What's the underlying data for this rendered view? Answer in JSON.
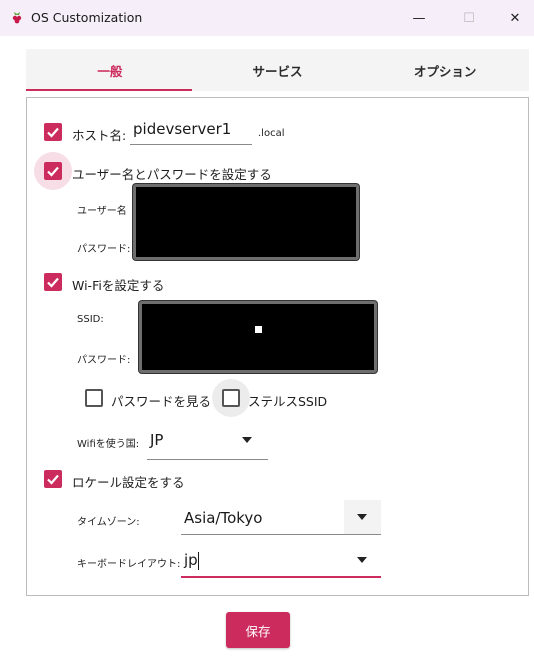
{
  "window": {
    "title": "OS Customization",
    "minimize_glyph": "—",
    "maximize_glyph": "☐",
    "close_glyph": "✕"
  },
  "tabs": [
    {
      "label": "一般",
      "active": true
    },
    {
      "label": "サービス",
      "active": false
    },
    {
      "label": "オプション",
      "active": false
    }
  ],
  "general": {
    "hostname": {
      "label": "ホスト名:",
      "value": "pidevserver1",
      "suffix": ".local",
      "checked": true
    },
    "user": {
      "label": "ユーザー名とパスワードを設定する",
      "checked": true,
      "username_label": "ユーザー名",
      "password_label": "パスワード:"
    },
    "wifi": {
      "label": "Wi-Fiを設定する",
      "checked": true,
      "ssid_label": "SSID:",
      "password_label": "パスワード:",
      "show_password": {
        "label": "パスワードを見る",
        "checked": false
      },
      "hidden_ssid": {
        "label": "ステルスSSID",
        "checked": false
      },
      "country_label": "Wifiを使う国:",
      "country_value": "JP"
    },
    "locale": {
      "label": "ロケール設定をする",
      "checked": true,
      "timezone_label": "タイムゾーン:",
      "timezone_value": "Asia/Tokyo",
      "keyboard_label": "キーボードレイアウト:",
      "keyboard_value": "jp"
    }
  },
  "footer": {
    "save_label": "保存"
  },
  "colors": {
    "accent": "#cc2b5e",
    "titlebar": "#f6eef9",
    "tab_bg": "#f4f4f4"
  },
  "icons": [
    "raspberry-pi-icon",
    "minimize-icon",
    "maximize-icon",
    "close-icon",
    "checkmark-icon",
    "dropdown-arrow-icon"
  ]
}
